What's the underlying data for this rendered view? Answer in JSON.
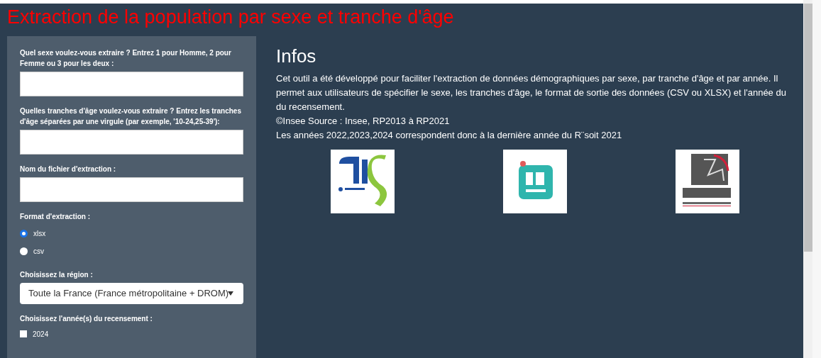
{
  "title": "Extraction de la population par sexe et tranche d'âge",
  "sidebar": {
    "fields": [
      {
        "kind": "text",
        "label": "Quel sexe voulez-vous extraire ? Entrez 1 pour Homme, 2 pour Femme ou 3 pour les deux :"
      },
      {
        "kind": "text",
        "label": "Quelles tranches d'âge voulez-vous extraire ? Entrez les tranches d'âge séparées par une virgule (par exemple, '10-24,25-39'):"
      },
      {
        "kind": "text",
        "label": "Nom du fichier d'extraction :"
      },
      {
        "kind": "radio",
        "label": "Format d'extraction :",
        "options": [
          {
            "label": "xlsx",
            "selected": true
          },
          {
            "label": "csv",
            "selected": false
          }
        ]
      },
      {
        "kind": "select",
        "label": "Choisissez la région :",
        "value": "Toute la France (France métropolitaine + DROM)"
      },
      {
        "kind": "checkbox",
        "label": "Choisissez l'année(s) du recensement :",
        "options": [
          {
            "label": "2024",
            "checked": false
          }
        ]
      }
    ]
  },
  "main": {
    "heading": "Infos",
    "paragraphs": [
      "Cet outil a été développé pour faciliter l'extraction de données démographiques par sexe, par tranche d'âge et par année. Il permet aux utilisateurs de spécifier le sexe, les tranches d'âge, le format de sortie des données (CSV ou XLSX) et l'année du du recensement.",
      "©Insee Source : Insee, RP2013 à RP2021",
      "Les années 2022,2023,2024 correspondent donc à la dernière année du R¨soit 2021"
    ]
  }
}
